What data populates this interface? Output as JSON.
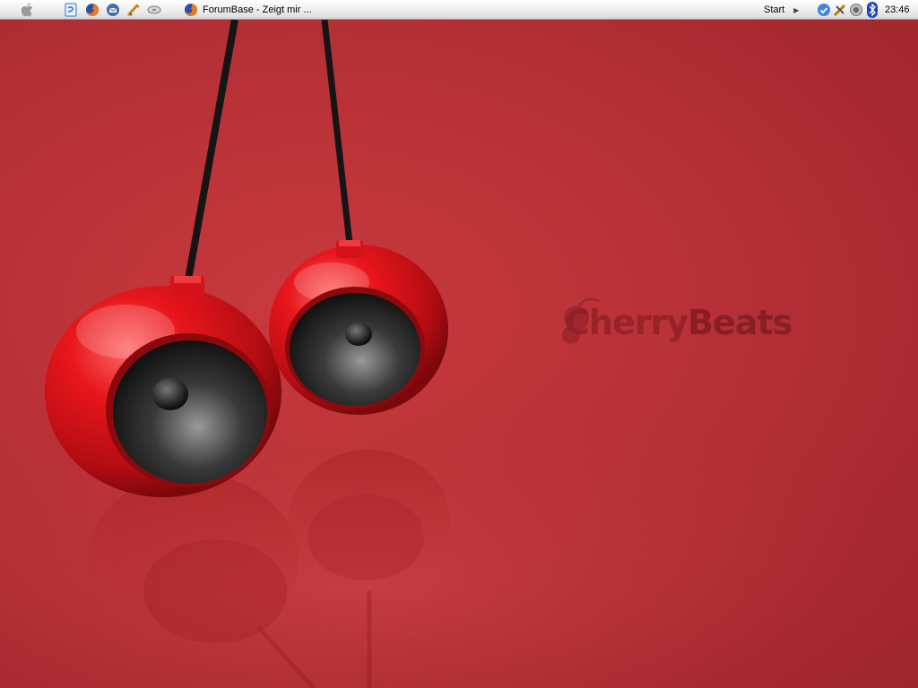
{
  "taskbar": {
    "quick_launch": [
      {
        "icon": "apple-menu-icon"
      },
      {
        "icon": "document-app-icon"
      },
      {
        "icon": "firefox-icon"
      },
      {
        "icon": "thunderbird-icon"
      },
      {
        "icon": "tools-icon"
      },
      {
        "icon": "disk-icon"
      }
    ],
    "active_task": {
      "icon": "firefox-icon",
      "label": "ForumBase - Zeigt mir ..."
    },
    "start_label": "Start",
    "tray_icons": [
      "update-check-icon",
      "network-tools-icon",
      "speaker-icon",
      "bluetooth-icon"
    ],
    "clock": "23:46"
  },
  "wallpaper": {
    "brand_part1": "Cherry",
    "brand_part2": "Beats",
    "colors": {
      "background": "#b93237",
      "speaker_red": "#e0161c",
      "brand_text": "#8a1f24"
    }
  }
}
